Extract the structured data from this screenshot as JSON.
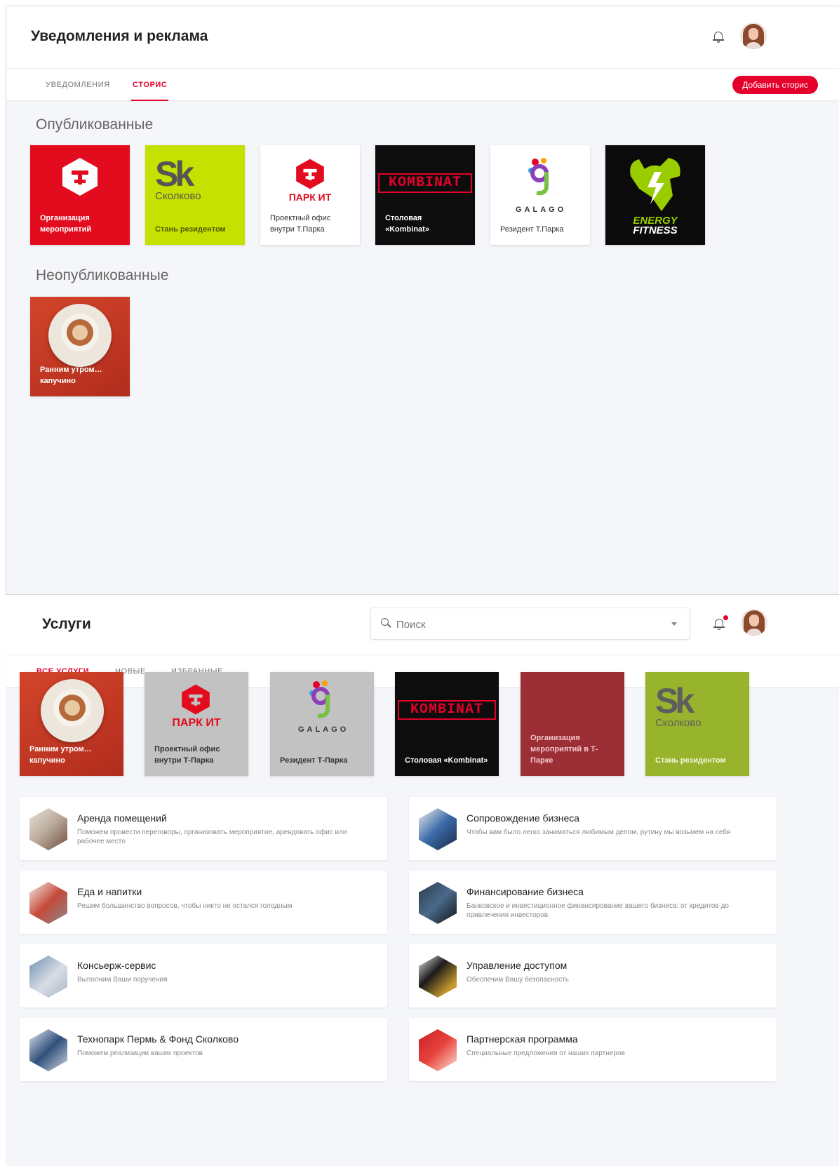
{
  "screen1": {
    "title": "Уведомления и реклама",
    "tabs": [
      {
        "label": "Уведомления"
      },
      {
        "label": "Сторис"
      }
    ],
    "add_story_label": "Добавить сторис",
    "published_title": "Опубликованные",
    "unpublished_title": "Неопубликованные",
    "published": [
      {
        "caption": "Организация мероприятий"
      },
      {
        "caption": "Стань резидентом",
        "logo": "Sk",
        "logo_name": "Сколково"
      },
      {
        "caption": "Проектный офис внутри Т.Парка",
        "logo": "ПАРК ИТ"
      },
      {
        "caption": "Столовая «Kombinat»",
        "logo": "KOMBINAT"
      },
      {
        "caption": "Резидент Т.Парка",
        "logo": "GALAGO"
      },
      {
        "logo_line1": "ENERGY",
        "logo_line2": "FITNESS"
      }
    ],
    "unpublished": [
      {
        "caption": "Ранним утром… капучино"
      }
    ]
  },
  "screen2": {
    "title": "Услуги",
    "search_placeholder": "Поиск",
    "tabs": [
      {
        "label": "Все услуги"
      },
      {
        "label": "Новые"
      },
      {
        "label": "Избранные"
      }
    ],
    "stories": [
      {
        "caption": "Ранним утром… капучино"
      },
      {
        "caption": "Проектный офис внутри Т-Парка",
        "logo": "ПАРК ИТ"
      },
      {
        "caption": "Резидент Т-Парка",
        "logo": "GALAGO"
      },
      {
        "caption": "Столовая «Kombinat»",
        "logo": "KOMBINAT"
      },
      {
        "caption": "Организация мероприятий в Т-Парке"
      },
      {
        "caption": "Стань резидентом",
        "logo": "Sk",
        "logo_name": "Сколково"
      }
    ],
    "services": [
      {
        "name": "Аренда помещений",
        "desc": "Поможем провести переговоры, организовать мероприятие, арендовать офис или рабочее место"
      },
      {
        "name": "Сопровождение бизнеса",
        "desc": "Чтобы вам было легко заниматься любимым делом, рутину мы возьмем на себя"
      },
      {
        "name": "Еда и напитки",
        "desc": "Решим большинство вопросов, чтобы никто не остался голодным"
      },
      {
        "name": "Финансирование бизнеса",
        "desc": "Банковское и инвестиционное финансирование вашего бизнеса: от кредитов до привлечения инвесторов."
      },
      {
        "name": "Консьерж-сервис",
        "desc": "Выполним Ваши поручения"
      },
      {
        "name": "Управление доступом",
        "desc": "Обеспечим Вашу безопасность"
      },
      {
        "name": "Технопарк Пермь & Фонд Сколково",
        "desc": "Поможем реализации ваших проектов"
      },
      {
        "name": "Партнерская программа",
        "desc": "Специальные предложения от наших партнеров"
      }
    ]
  },
  "colors": {
    "accent": "#e4002b",
    "sk_green": "#c5e100",
    "sk_green_muted": "#98b32c",
    "maroon": "#9c2f36"
  }
}
